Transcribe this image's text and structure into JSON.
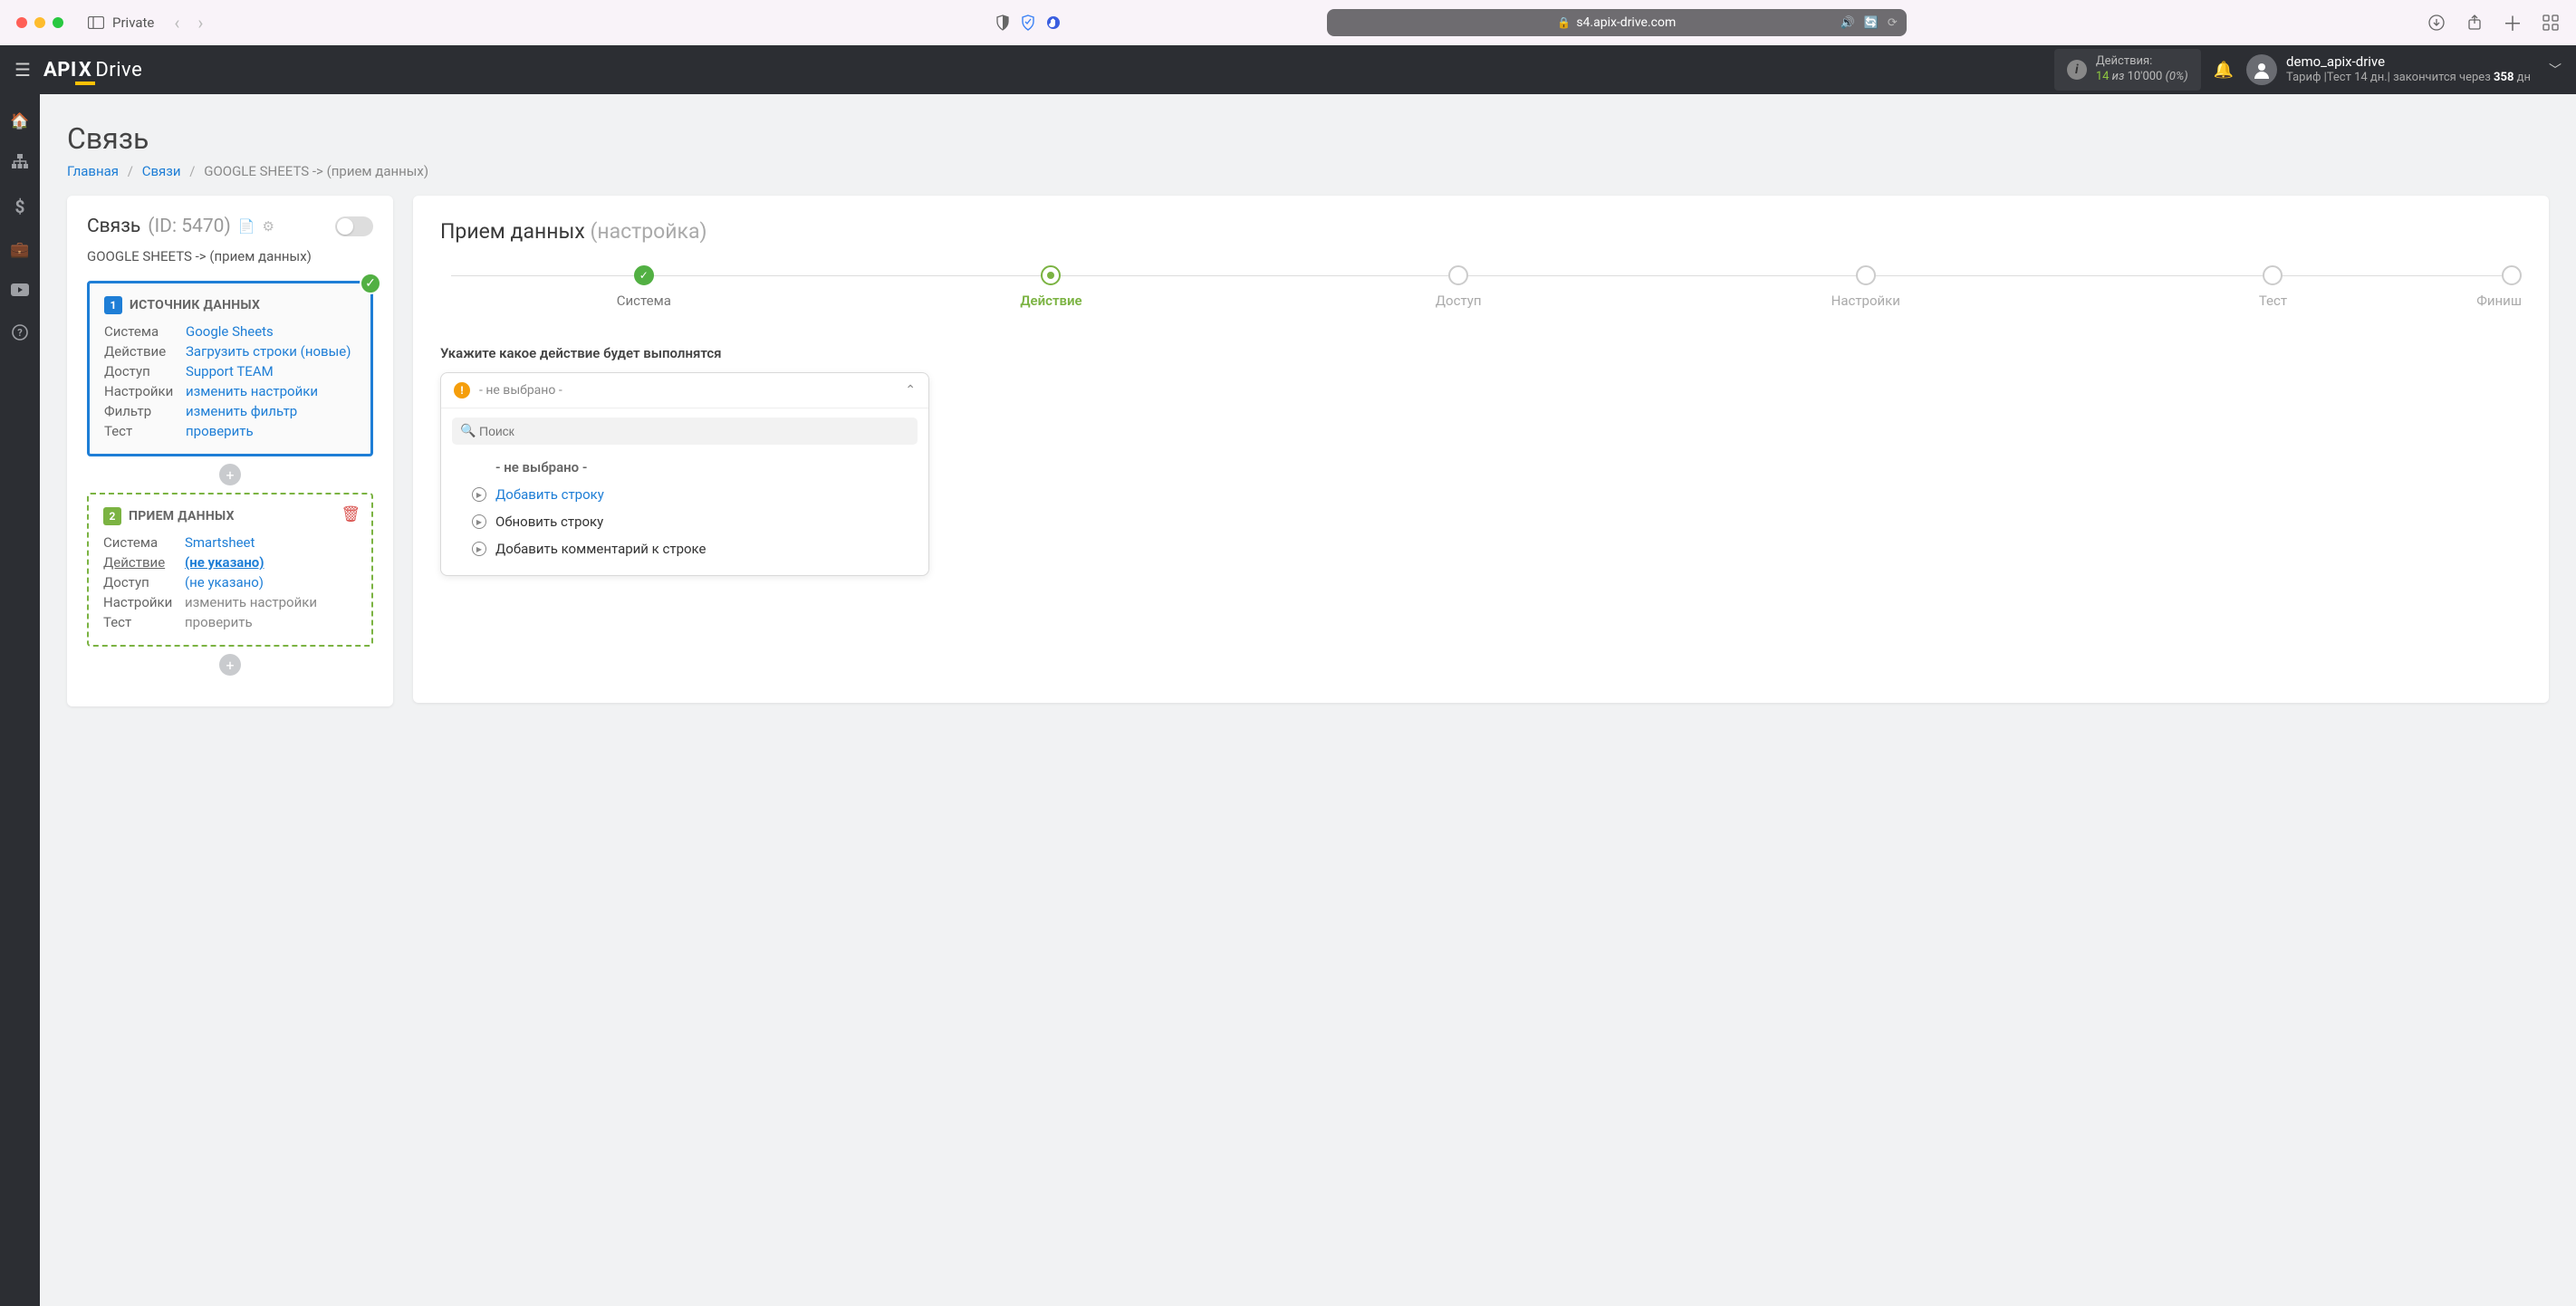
{
  "browser": {
    "private": "Private",
    "url": "s4.apix-drive.com"
  },
  "logo": {
    "api": "API",
    "x": "X",
    "drive": "Drive"
  },
  "header": {
    "actions_label": "Действия:",
    "actions_count": "14",
    "actions_of": " из ",
    "actions_max": "10'000",
    "actions_pct": " (0%)",
    "user": "demo_apix-drive",
    "tariff_pre": "Тариф |Тест 14 дн.| закончится через ",
    "tariff_days": "358",
    "tariff_post": " дн"
  },
  "page": {
    "title": "Связь",
    "bc_home": "Главная",
    "bc_links": "Связи",
    "bc_current": "GOOGLE SHEETS -> (прием данных)"
  },
  "leftcard": {
    "title": "Связь",
    "id_text": "(ID: 5470)",
    "subtitle": "GOOGLE SHEETS -> (прием данных)",
    "source": {
      "num": "1",
      "name": "ИСТОЧНИК ДАННЫХ",
      "rows": {
        "system_l": "Система",
        "system_v": "Google Sheets",
        "action_l": "Действие",
        "action_v": "Загрузить строки (новые)",
        "access_l": "Доступ",
        "access_v": "Support TEAM",
        "settings_l": "Настройки",
        "settings_v": "изменить настройки",
        "filter_l": "Фильтр",
        "filter_v": "изменить фильтр",
        "test_l": "Тест",
        "test_v": "проверить"
      }
    },
    "receiver": {
      "num": "2",
      "name": "ПРИЕМ ДАННЫХ",
      "rows": {
        "system_l": "Система",
        "system_v": "Smartsheet",
        "action_l": "Действие",
        "action_v": "(не указано)",
        "access_l": "Доступ",
        "access_v": "(не указано)",
        "settings_l": "Настройки",
        "settings_v": "изменить настройки",
        "test_l": "Тест",
        "test_v": "проверить"
      }
    }
  },
  "right": {
    "title": "Прием данных",
    "title_sub": "(настройка)",
    "steps": {
      "system": "Система",
      "action": "Действие",
      "access": "Доступ",
      "settings": "Настройки",
      "test": "Тест",
      "finish": "Финиш"
    },
    "field_label": "Укажите какое действие будет выполнятся",
    "dd": {
      "placeholder": "- не выбрано -",
      "search_ph": "Поиск",
      "opt_none": "- не выбрано -",
      "opt_add": "Добавить строку",
      "opt_update": "Обновить строку",
      "opt_comment": "Добавить комментарий к строке"
    }
  }
}
